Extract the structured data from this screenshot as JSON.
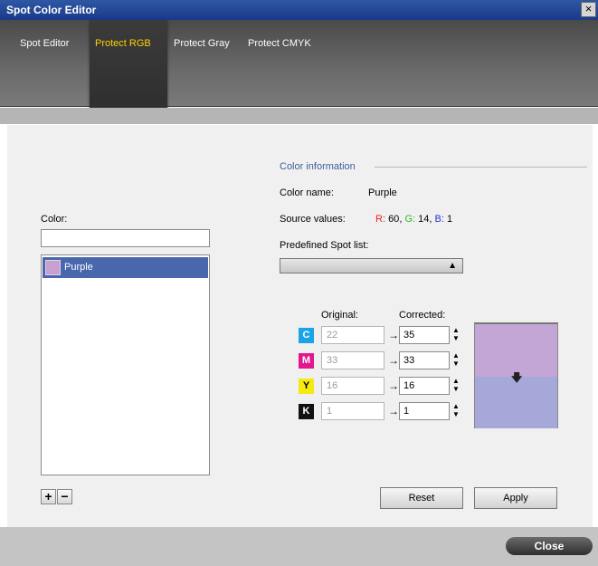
{
  "window": {
    "title": "Spot Color Editor",
    "close_glyph": "×"
  },
  "tabs": [
    {
      "label": "Spot Editor",
      "active": false
    },
    {
      "label": "Protect RGB",
      "active": true
    },
    {
      "label": "Protect Gray",
      "active": false
    },
    {
      "label": "Protect CMYK",
      "active": false
    }
  ],
  "left": {
    "color_label": "Color:",
    "name_value": "",
    "list": [
      {
        "label": "Purple",
        "swatch": "#c8a0d0",
        "selected": true
      }
    ],
    "add_glyph": "+",
    "remove_glyph": "−"
  },
  "info": {
    "section_title": "Color information",
    "color_name_label": "Color name:",
    "color_name_value": "Purple",
    "source_label": "Source values:",
    "source": {
      "r_label": "R:",
      "r_value": "60",
      "g_label": "G:",
      "g_value": "14",
      "b_label": "B:",
      "b_value": "1"
    },
    "predefined_label": "Predefined Spot list:",
    "predefined_value": ""
  },
  "cmyk": {
    "original_header": "Original:",
    "corrected_header": "Corrected:",
    "rows": [
      {
        "channel": "C",
        "color": "#1aa3e8",
        "original": "22",
        "corrected": "35"
      },
      {
        "channel": "M",
        "color": "#e3168f",
        "original": "33",
        "corrected": "33"
      },
      {
        "channel": "Y",
        "color": "#f5ea10",
        "original": "16",
        "corrected": "16"
      },
      {
        "channel": "K",
        "color": "#111111",
        "original": "1",
        "corrected": "1"
      }
    ]
  },
  "preview": {
    "original_color": "#c4a6d6",
    "corrected_color": "#a6a8da"
  },
  "buttons": {
    "reset": "Reset",
    "apply": "Apply",
    "close": "Close"
  }
}
